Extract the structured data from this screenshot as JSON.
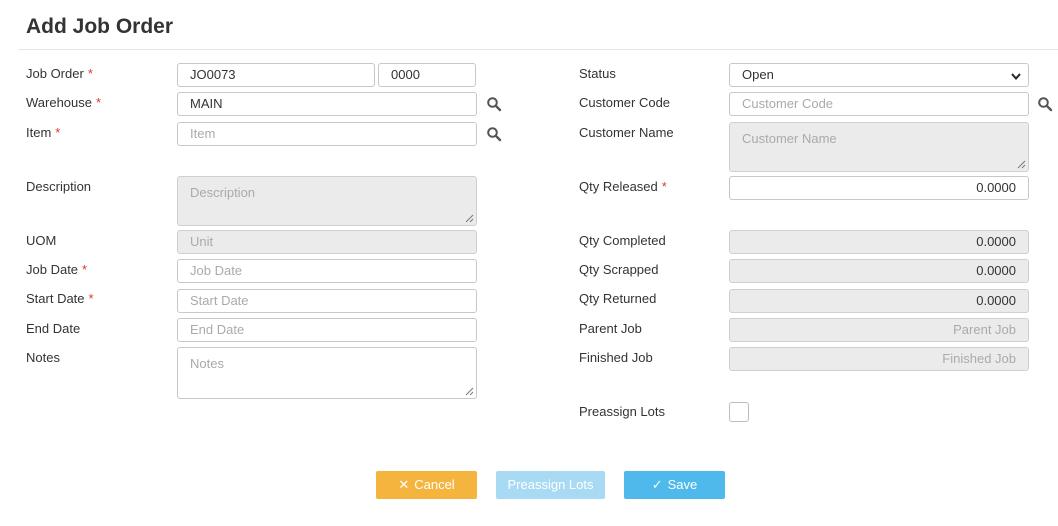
{
  "title": "Add Job Order",
  "required_mark": "*",
  "left": {
    "job_order_label": "Job Order",
    "job_order_value": "JO0073",
    "job_order_suffix": "0000",
    "warehouse_label": "Warehouse",
    "warehouse_value": "MAIN",
    "item_label": "Item",
    "item_placeholder": "Item",
    "description_label": "Description",
    "description_placeholder": "Description",
    "uom_label": "UOM",
    "uom_placeholder": "Unit",
    "job_date_label": "Job Date",
    "job_date_placeholder": "Job Date",
    "start_date_label": "Start Date",
    "start_date_placeholder": "Start Date",
    "end_date_label": "End Date",
    "end_date_placeholder": "End Date",
    "notes_label": "Notes",
    "notes_placeholder": "Notes"
  },
  "right": {
    "status_label": "Status",
    "status_value": "Open",
    "customer_code_label": "Customer Code",
    "customer_code_placeholder": "Customer Code",
    "customer_name_label": "Customer Name",
    "customer_name_placeholder": "Customer Name",
    "qty_released_label": "Qty Released",
    "qty_released_value": "0.0000",
    "qty_completed_label": "Qty Completed",
    "qty_completed_value": "0.0000",
    "qty_scrapped_label": "Qty Scrapped",
    "qty_scrapped_value": "0.0000",
    "qty_returned_label": "Qty Returned",
    "qty_returned_value": "0.0000",
    "parent_job_label": "Parent Job",
    "parent_job_placeholder": "Parent Job",
    "finished_job_label": "Finished Job",
    "finished_job_placeholder": "Finished Job",
    "preassign_lots_label": "Preassign Lots"
  },
  "buttons": {
    "cancel_label": "Cancel",
    "preassign_label": "Preassign Lots",
    "save_label": "Save"
  },
  "colors": {
    "cancel": "#f5b43d",
    "preassign": "#a8daf4",
    "save": "#4fb9ec",
    "required": "#e3342f"
  },
  "icons": {
    "search": "search-icon",
    "chevron": "chevron-down-icon",
    "cancel": "close-icon",
    "save": "check-icon"
  }
}
